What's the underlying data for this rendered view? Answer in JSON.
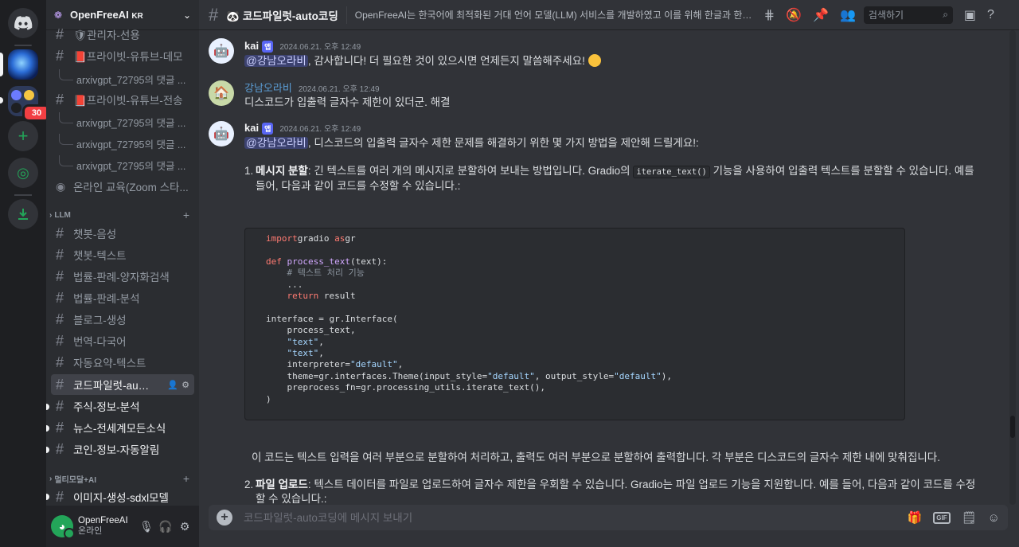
{
  "server": {
    "name": "OpenFreeAI",
    "suffix": "KR",
    "unread_badge": "30"
  },
  "sidebar": {
    "top_items": [
      {
        "type": "channel",
        "label": "🛡관리자-선용"
      },
      {
        "type": "channel",
        "label": "📕프라이빗-유튜브-데모"
      },
      {
        "type": "thread",
        "label": "arxivgpt_72795의 댓글 ..."
      },
      {
        "type": "channel",
        "label": "📕프라이빗-유튜브-전송"
      },
      {
        "type": "thread",
        "label": "arxivgpt_72795의 댓글 ..."
      },
      {
        "type": "thread",
        "label": "arxivgpt_72795의 댓글 ..."
      },
      {
        "type": "thread",
        "label": "arxivgpt_72795의 댓글 ..."
      },
      {
        "type": "voice",
        "label": "온라인 교육(Zoom 스타..."
      }
    ],
    "category_llm": "LLM",
    "llm_channels": [
      "챗봇-음성",
      "챗봇-텍스트",
      "법률-판례-양자화검색",
      "법률-판례-분석",
      "블로그-생성",
      "번역-다국어",
      "자동요약-텍스트",
      "코드파일럿-auto코딩"
    ],
    "unread_channels": [
      "주식-정보-분석",
      "뉴스-전세계모든소식",
      "코인-정보-자동알림"
    ],
    "category_multimodal": "멀티모달+AI",
    "multimodal_channels": [
      "이미지-생성-sdxl모델"
    ]
  },
  "user": {
    "name": "OpenFreeAI",
    "status": "온라인"
  },
  "topbar": {
    "channel": "코드파일럿-auto코딩",
    "topic": "OpenFreeAI는 한국어에 최적화된 거대 언어 모델(LLM) 서비스를 개발하였고 이를 위해 한글과 한국...",
    "search_placeholder": "검색하기"
  },
  "messages": [
    {
      "author": "kai",
      "tag": "앱",
      "time": "2024.06.21. 오후 12:49",
      "mention": "@강남오라비",
      "text": ", 감사합니다! 더 필요한 것이 있으시면 언제든지 말씀해주세요!"
    },
    {
      "author": "강남오라비",
      "time": "2024.06.21. 오후 12:49",
      "text": "디스코드가 입출력 글자수 제한이 있더군. 해결"
    },
    {
      "author": "kai",
      "tag": "앱",
      "time": "2024.06.21. 오후 12:49",
      "mention": "@강남오라비",
      "text": ", 디스코드의 입출력 글자수 제한 문제를 해결하기 위한 몇 가지 방법을 제안해 드릴게요!:"
    }
  ],
  "item1": {
    "num": "1.",
    "title": "메시지 분할",
    "text_a": ": 긴 텍스트를 여러 개의 메시지로 분할하여 보내는 방법입니다. Gradio의 ",
    "code": "iterate_text()",
    "text_b": " 기능을 사용하여 입출력 텍스트를 분할할 수 있습니다. 예를",
    "text_c": "들어, 다음과 같이 코드를 수정할 수 있습니다.:"
  },
  "code_lines": [
    [
      [
        "kw",
        "import"
      ],
      [
        "",
        "gradio "
      ],
      [
        "kw",
        "as"
      ],
      [
        "",
        "gr"
      ]
    ],
    [],
    [
      [
        "kw",
        "def "
      ],
      [
        "fn",
        "process_text"
      ],
      [
        "",
        "(text):"
      ]
    ],
    [
      [
        "",
        "    "
      ],
      [
        "cm",
        "# 텍스트 처리 기능"
      ]
    ],
    [
      [
        "",
        "    ..."
      ]
    ],
    [
      [
        "",
        "    "
      ],
      [
        "kw",
        "return"
      ],
      [
        "",
        " result"
      ]
    ],
    [],
    [
      [
        "",
        "interface = gr.Interface("
      ]
    ],
    [
      [
        "",
        "    process_text,"
      ]
    ],
    [
      [
        "",
        "    "
      ],
      [
        "str",
        "\"text\""
      ],
      [
        "",
        ","
      ]
    ],
    [
      [
        "",
        "    "
      ],
      [
        "str",
        "\"text\""
      ],
      [
        "",
        ","
      ]
    ],
    [
      [
        "",
        "    interpreter="
      ],
      [
        "str",
        "\"default\""
      ],
      [
        "",
        ","
      ]
    ],
    [
      [
        "",
        "    theme=gr.interfaces.Theme(input_style="
      ],
      [
        "str",
        "\"default\""
      ],
      [
        "",
        ", output_style="
      ],
      [
        "str",
        "\"default\""
      ],
      [
        "",
        "),"
      ]
    ],
    [
      [
        "",
        "    preprocess_fn=gr.processing_utils.iterate_text(),"
      ]
    ],
    [
      [
        "",
        ")"
      ]
    ]
  ],
  "para": "이 코드는 텍스트 입력을 여러 부분으로 분할하여 처리하고, 출력도 여러 부분으로 분할하여 출력합니다. 각 부분은 디스코드의 글자수 제한 내에 맞춰집니다.",
  "item2": {
    "num": "2.",
    "title": "파일 업로드",
    "text_a": ": 텍스트 데이터를 파일로 업로드하여 글자수 제한을 우회할 수 있습니다. Gradio는 파일 업로드 기능을 지원합니다. 예를 들어, 다음과 같이 코드를 수정",
    "text_b": "할 수 있습니다.:"
  },
  "composer": {
    "placeholder": "코드파일럿-auto코딩에 메시지 보내기",
    "gif_label": "GIF"
  }
}
